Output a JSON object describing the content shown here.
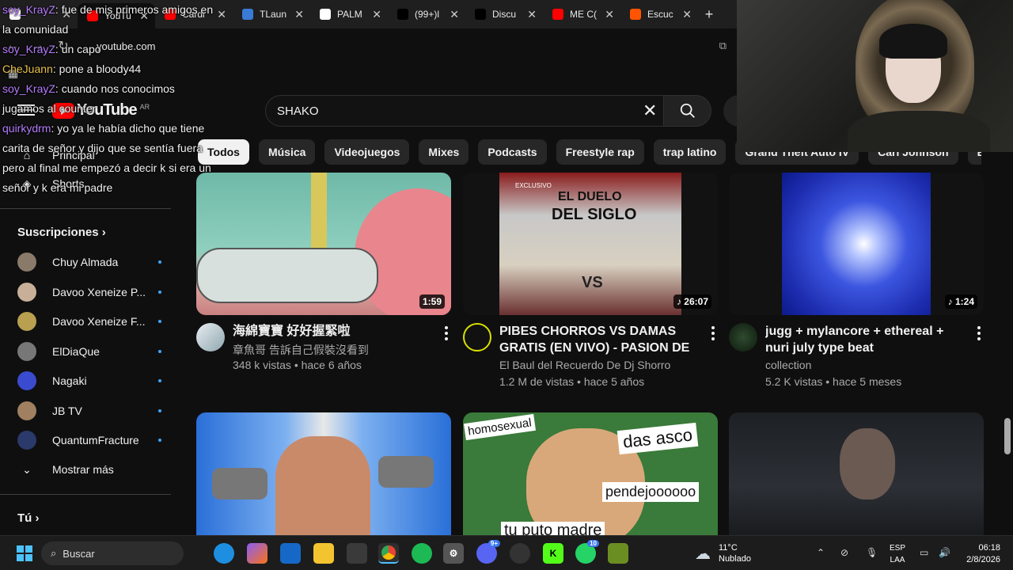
{
  "browser": {
    "tabs": [
      {
        "label": "",
        "color": "#ffffff"
      },
      {
        "label": "YouTu",
        "color": "#ff0000",
        "active": true
      },
      {
        "label": "Cardi",
        "color": "#ff0000"
      },
      {
        "label": "TLaun",
        "color": "#3a7bd5"
      },
      {
        "label": "PALM",
        "color": "#ffffff"
      },
      {
        "label": "(99+)l",
        "color": "#000000"
      },
      {
        "label": "Discu",
        "color": "#000000"
      },
      {
        "label": "ME C(",
        "color": "#ff0000"
      },
      {
        "label": "Escuc",
        "color": "#ff5500"
      }
    ],
    "new_tab": "+",
    "url": "youtube.com"
  },
  "chat": [
    {
      "user": "soy_KrayZ",
      "text": "fue de mis primeros amigos en",
      "color": "#b57bff"
    },
    {
      "user": "",
      "text": "la comunidad",
      "color": "#f1f1f1"
    },
    {
      "user": "soy_KrayZ",
      "text": "un capo",
      "color": "#b57bff"
    },
    {
      "user": "CheJuann",
      "text": "pone a bloody44",
      "color": "#e8c14a"
    },
    {
      "user": "soy_KrayZ",
      "text": "cuando nos conocimos",
      "color": "#b57bff"
    },
    {
      "user": "",
      "text": "jugamos al counter",
      "color": "#f1f1f1"
    },
    {
      "user": "quirkydrm",
      "text": "yo ya le había dicho que tiene",
      "color": "#b57bff"
    },
    {
      "user": "",
      "text": "carita de señor y dijo que se sentía fuera",
      "color": "#f1f1f1"
    },
    {
      "user": "",
      "text": "pero al final me empezó a decir k si era un",
      "color": "#f1f1f1"
    },
    {
      "user": "",
      "text": "señor y k era mi padre",
      "color": "#f1f1f1"
    }
  ],
  "youtube": {
    "logo_text": "YouTube",
    "country": "AR",
    "search_value": "SHAKO",
    "chips": [
      "Todos",
      "Música",
      "Videojuegos",
      "Mixes",
      "Podcasts",
      "Freestyle rap",
      "trap latino",
      "Grand Theft Auto IV",
      "Carl Johnson",
      "Boxeo profesio"
    ],
    "sidebar": {
      "home": "Principal",
      "shorts": "Shorts",
      "subscriptions_title": "Suscripciones",
      "subscriptions": [
        "Chuy Almada",
        "Davoo Xeneize P...",
        "Davoo Xeneize F...",
        "ElDiaQue",
        "Nagaki",
        "JB TV",
        "QuantumFracture"
      ],
      "show_more": "Mostrar más",
      "you": "Tú"
    },
    "videos": [
      {
        "title": "海綿寶寶 好好握緊啦",
        "channel": "章魚哥 告訴自己假裝沒看到",
        "stats": "348 k vistas • hace 6 años",
        "duration": "1:59"
      },
      {
        "title": "PIBES CHORROS VS DAMAS GRATIS (EN VIVO) - PASION DE SABADO - D...",
        "channel": "El Baul del Recuerdo De Dj Shorro",
        "stats": "1.2 M de vistas • hace 5 años",
        "duration": "♪ 26:07",
        "thumb_text": [
          "EXCLUSIVO",
          "EL DUELO",
          "DEL SIGLO",
          "VS"
        ]
      },
      {
        "title": "jugg + mylancore + ethereal + nuri july type beat @ccollectionn",
        "channel": "collection",
        "stats": "5.2 K vistas • hace 5 meses",
        "duration": "♪ 1:24"
      }
    ],
    "row2_texts": [
      "homosexual",
      "das asco",
      "pendejoooooo",
      "tu puto madre"
    ]
  },
  "taskbar": {
    "search": "Buscar",
    "weather_temp": "11°C",
    "weather_desc": "Nublado",
    "lang1": "ESP",
    "lang2": "LAA",
    "time": "06:18",
    "date": "2/8/2026",
    "badges": [
      "9+",
      "10"
    ]
  }
}
